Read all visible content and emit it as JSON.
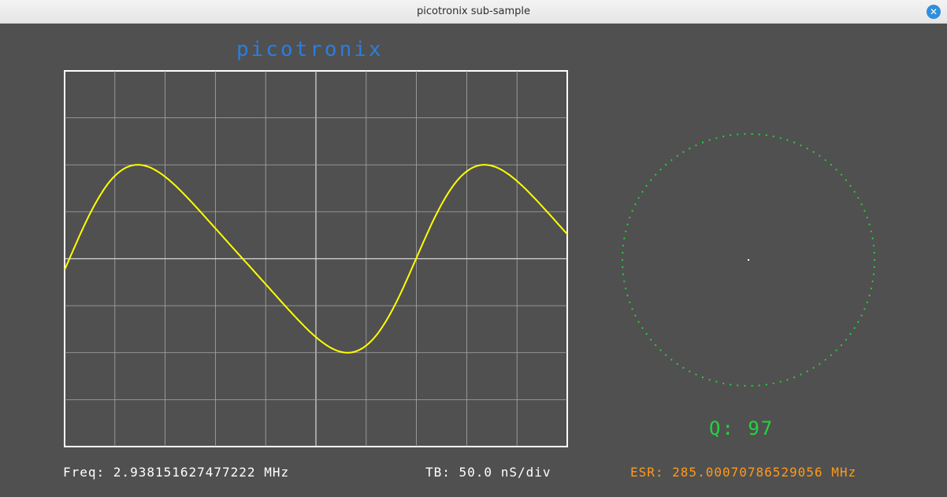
{
  "window": {
    "title": "picotronix sub-sample",
    "close_glyph": "✕"
  },
  "brand": "picotronix",
  "readouts": {
    "freq": "Freq: 2.938151627477222 MHz",
    "tb": "TB: 50.0 nS/div",
    "q": "Q: 97",
    "esr": "ESR: 285.00070786529056 MHz"
  },
  "scope": {
    "h_divisions": 10,
    "v_divisions": 8,
    "trace_color": "#ffff00",
    "grid_color": "#a8a8a8",
    "frame_color": "#ffffff",
    "trace_cycles": 1.45,
    "trace_phase_deg": 355,
    "trace_amplitude_div": 2.0,
    "trace_skew": 0.35
  },
  "polar_plot": {
    "dot_color": "#22d63a",
    "center_color": "#ffffff",
    "dot_count": 110,
    "center_marker": "point"
  },
  "colors": {
    "background": "#505050",
    "brand": "#2a7de1",
    "q": "#22d63a",
    "esr": "#ff9a1a",
    "readout": "#ffffff"
  }
}
